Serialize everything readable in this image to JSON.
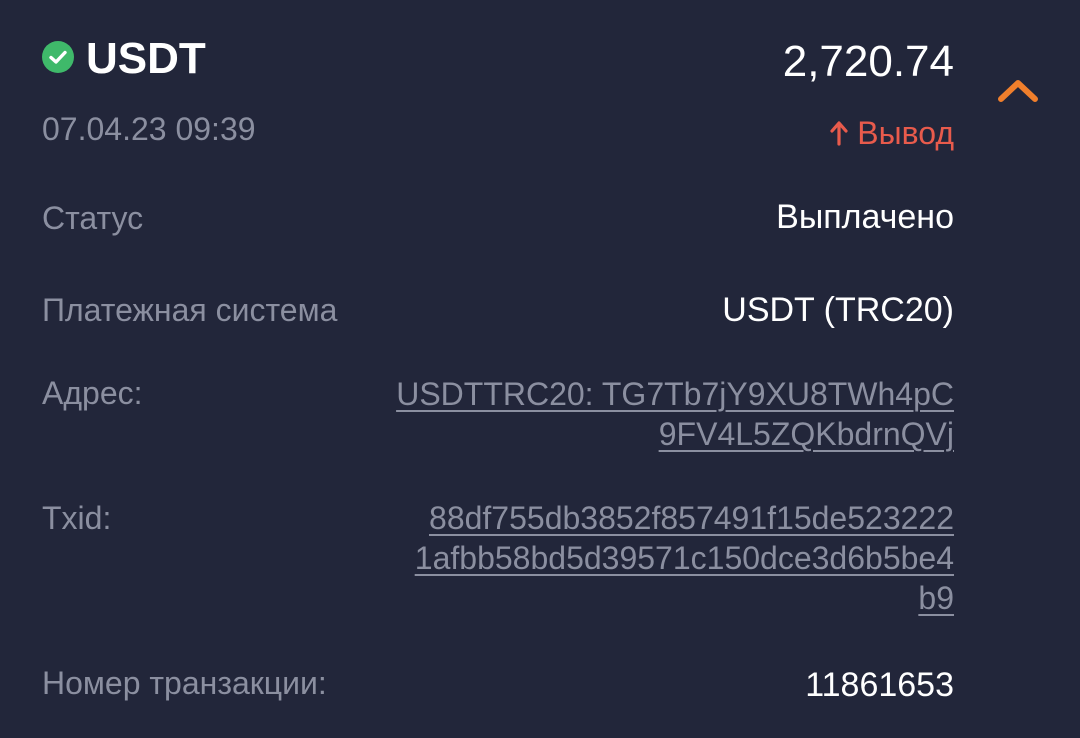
{
  "header": {
    "currency": "USDT",
    "amount": "2,720.74",
    "date": "07.04.23 09:39",
    "type": "Вывод",
    "colors": {
      "success": "#3fb96a",
      "withdraw": "#e85b4c",
      "accent": "#f07f2c",
      "background": "#22263a",
      "muted": "#8b8fa0"
    }
  },
  "details": {
    "status": {
      "label": "Статус",
      "value": "Выплачено"
    },
    "payment_system": {
      "label": "Платежная система",
      "value": "USDT (TRC20)"
    },
    "address": {
      "label": "Адрес:",
      "lines": [
        "USDTTRC20: TG7Tb7jY9XU8TWh4pC",
        "9FV4L5ZQKbdrnQVj"
      ]
    },
    "txid": {
      "label": "Txid:",
      "lines": [
        "88df755db3852f857491f15de523222",
        "1afbb58bd5d39571c150dce3d6b5be4",
        "b9"
      ]
    },
    "transaction_number": {
      "label": "Номер транзакции:",
      "value": "11861653"
    }
  },
  "icons": {
    "status": "check-circle-icon",
    "type": "arrow-up-icon",
    "collapse": "chevron-up-icon"
  }
}
